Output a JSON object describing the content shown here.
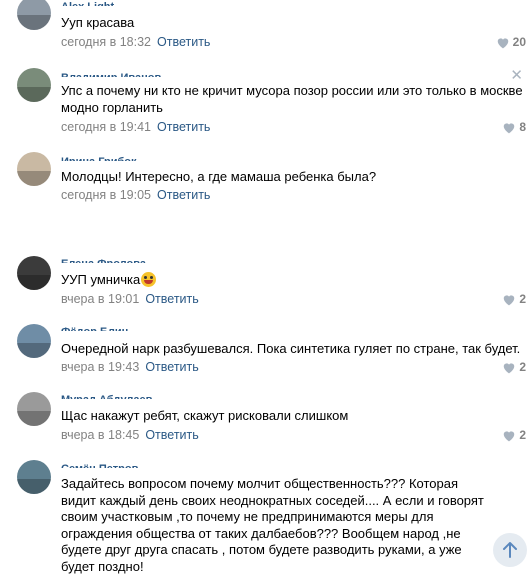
{
  "comments": [
    {
      "author": "Alex Light",
      "text": "Ууп красава",
      "time": "сегодня в 18:32",
      "reply": "Ответить",
      "likes": "20",
      "avatar_color": "#8e9aa6"
    },
    {
      "author": "Владимир Иванов",
      "text": "Упс а почему ни кто не кричит мусора позор россии или это только в москве модно горланить",
      "time": "сегодня в 19:41",
      "reply": "Ответить",
      "likes": "8",
      "avatar_color": "#7a8c7a"
    },
    {
      "author": "Ирина Грибок",
      "text": "Молодцы! Интересно, а где мамаша ребенка была?",
      "time": "сегодня в 19:05",
      "reply": "Ответить",
      "likes": "",
      "avatar_color": "#c9b9a3"
    },
    {
      "author": "Елена Фролова",
      "text": "УУП умничка",
      "time": "вчера в 19:01",
      "reply": "Ответить",
      "likes": "2",
      "avatar_color": "#3b3b3b"
    },
    {
      "author": "Фёдор Блин",
      "text": "Очередной нарк разбушевался. Пока синтетика гуляет по стране, так будет.",
      "time": "вчера в 19:43",
      "reply": "Ответить",
      "likes": "2",
      "avatar_color": "#6f8da6"
    },
    {
      "author": "Мурад Абдулаев",
      "text": "Щас накажут ребят, скажут рисковали слишком",
      "time": "вчера в 18:45",
      "reply": "Ответить",
      "likes": "2",
      "avatar_color": "#9a9a9a"
    },
    {
      "author": "Семён Петров",
      "text": "Задайтесь вопросом почему молчит общественность??? Которая видит каждый день своих неоднократных соседей.... А если и говорят своим участковым ,то почему не предпринимаются меры для ограждения общества от таких далбаебов??? Вообщем народ ,не будете друг друга спасать , потом будете разводить руками, а уже будет поздно!",
      "time": "",
      "reply": "",
      "likes": "",
      "avatar_color": "#5e7f8f"
    }
  ],
  "ui": {
    "close_symbol": "✕",
    "like_icon": "heart-icon",
    "scroll_icon": "arrow-up-icon"
  },
  "colors": {
    "link": "#2a5885",
    "meta": "#828282",
    "background": "#ffffff"
  }
}
